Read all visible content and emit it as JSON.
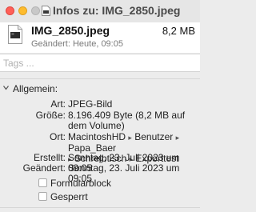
{
  "window": {
    "title": "Infos zu: IMG_2850.jpeg",
    "icon": "jpeg-file-icon"
  },
  "file": {
    "name": "IMG_2850.jpeg",
    "size": "8,2 MB",
    "modified": "Geändert: Heute, 09:05",
    "icon": "jpeg-file-icon"
  },
  "tags": {
    "placeholder": "Tags ..."
  },
  "general": {
    "title": "Allgemein:",
    "rows": [
      {
        "label": "Art:",
        "value": "JPEG-Bild"
      },
      {
        "label": "Größe:",
        "value": "8.196.409 Byte (8,2 MB auf dem Volume)"
      },
      {
        "label": "Ort:",
        "path": [
          "MacintoshHD",
          "Benutzer",
          "Papa_Baer",
          "Schreibtisch",
          "Exporttest"
        ]
      },
      {
        "label": "Erstellt:",
        "value": "Sonntag, 23. Juli 2023 um 09:05"
      },
      {
        "label": "Geändert:",
        "value": "Sonntag, 23. Juli 2023 um 09:05"
      }
    ],
    "checkboxes": [
      {
        "label": "Formularblock",
        "checked": false
      },
      {
        "label": "Gesperrt",
        "checked": false
      }
    ]
  }
}
